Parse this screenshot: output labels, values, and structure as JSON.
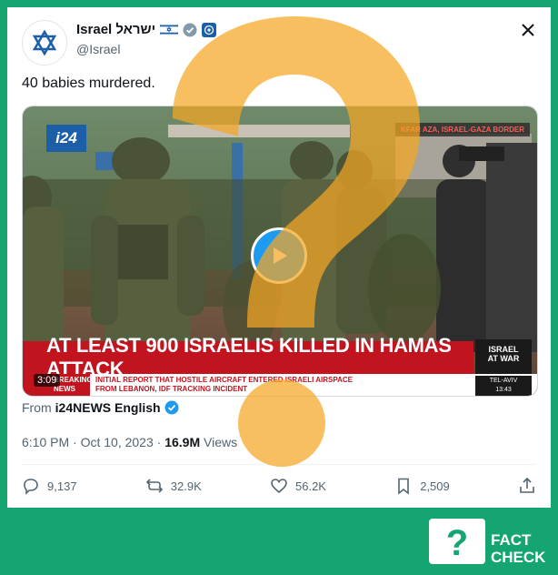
{
  "account": {
    "display_name": "Israel ישראל",
    "handle": "@Israel",
    "avatar_icon": "star-of-david-icon",
    "flag_icon": "israel-flag-icon",
    "verified_icon": "gray-verified-badge-icon",
    "org_icon": "government-emblem-icon"
  },
  "tweet": {
    "text": "40 babies murdered."
  },
  "media": {
    "channel_logo": "i24",
    "location": "KFAR AZA, ISRAEL-GAZA BORDER",
    "headline": "AT LEAST 900 ISRAELIS KILLED IN HAMAS ATTACK",
    "war_box": [
      "ISRAEL",
      "AT WAR"
    ],
    "breaking": [
      "BREAKING",
      "NEWS"
    ],
    "ticker": [
      "INITIAL REPORT THAT HOSTILE AIRCRAFT ENTERED ISRAELI AIRSPACE",
      "FROM LEBANON, IDF TRACKING INCIDENT"
    ],
    "timezone": [
      "TEL-AVIV",
      "13:43"
    ],
    "duration": "3:09"
  },
  "source": {
    "prefix": "From",
    "name": "i24NEWS English"
  },
  "meta": {
    "time": "6:10 PM",
    "date": "Oct 10, 2023",
    "views_count": "16.9M",
    "views_label": "Views"
  },
  "actions": {
    "replies": "9,137",
    "reposts": "32.9K",
    "likes": "56.2K",
    "bookmarks": "2,509"
  },
  "colors": {
    "background": "#15a570",
    "accent": "#1d9bf0",
    "overlay": "#f5a623"
  },
  "overlay": {
    "symbol": "?",
    "factcheck_text": [
      "FACT",
      "CHECK"
    ]
  }
}
